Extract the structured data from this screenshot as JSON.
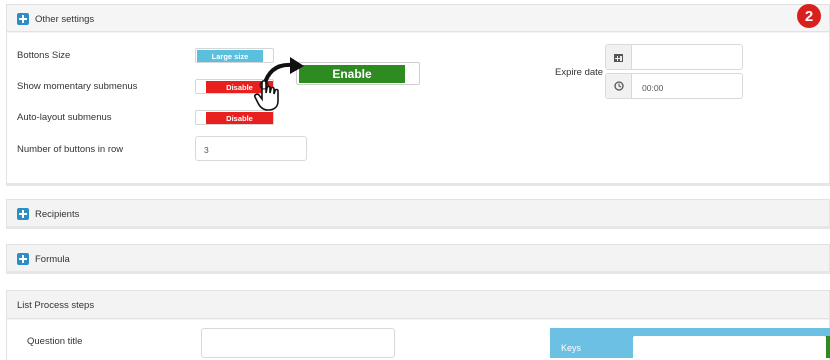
{
  "step_badge": "2",
  "other_settings": {
    "title": "Other settings",
    "buttons_size_label": "Bottons Size",
    "buttons_size_value": "Large size",
    "show_momentary_label": "Show momentary submenus",
    "show_momentary_value": "Disable",
    "enable_callout": "Enable",
    "auto_layout_label": "Auto-layout submenus",
    "auto_layout_value": "Disable",
    "buttons_in_row_label": "Number of buttons in row",
    "buttons_in_row_value": "3",
    "expire_date_label": "Expire date",
    "expire_date_value": "",
    "expire_time_value": "00:00"
  },
  "recipients": {
    "title": "Recipients"
  },
  "formula": {
    "title": "Formula"
  },
  "list_process": {
    "title": "List Process steps",
    "question_title_label": "Question title",
    "question_title_value": "",
    "keys_label": "Keys"
  },
  "colors": {
    "accent_blue": "#2c8ec4",
    "large_size_blue": "#5bc0de",
    "disable_red": "#e8201e",
    "enable_green": "#2e8b22",
    "badge_red": "#d9201f"
  },
  "icons": [
    "plus-square-icon",
    "calendar-icon",
    "clock-icon",
    "arrow-icon",
    "hand-pointer-icon"
  ]
}
